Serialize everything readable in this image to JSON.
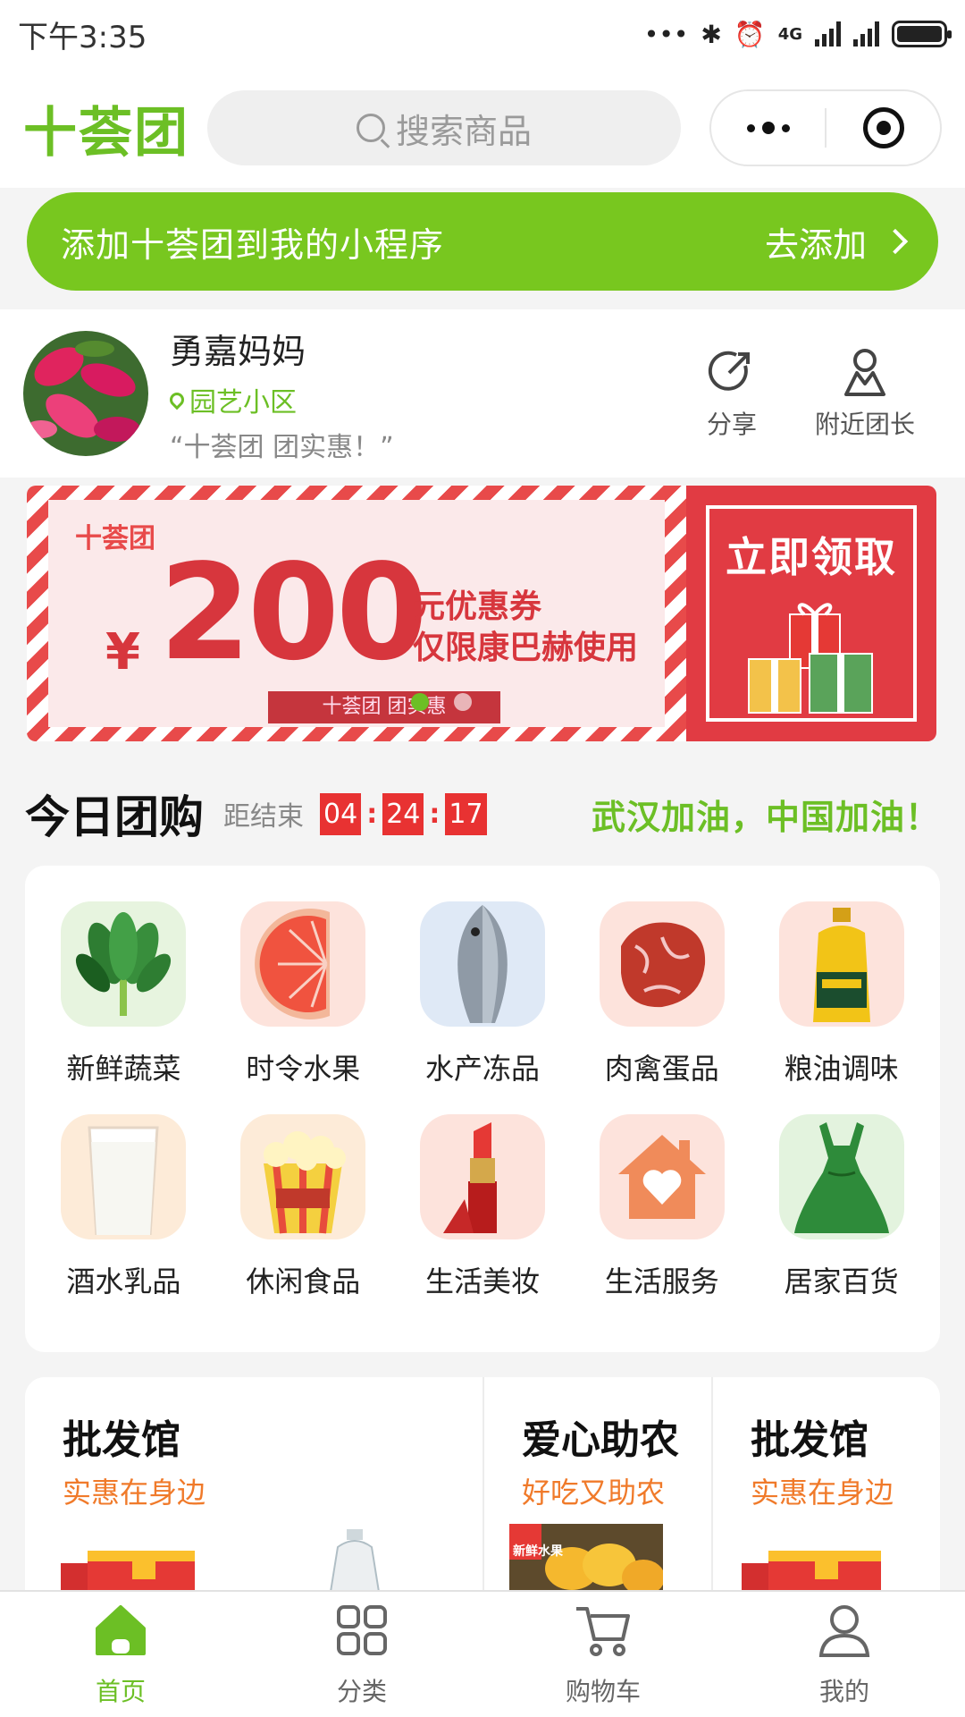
{
  "status_bar": {
    "time": "下午3:35",
    "network": "4G"
  },
  "header": {
    "logo": "十荟团",
    "search_placeholder": "搜索商品"
  },
  "add_banner": {
    "text": "添加十荟团到我的小程序",
    "action": "去添加"
  },
  "leader": {
    "name": "勇嘉妈妈",
    "location": "园艺小区",
    "quote": "“十荟团 团实惠！”",
    "share_label": "分享",
    "nearby_label": "附近团长"
  },
  "coupon": {
    "brand": "十荟团",
    "currency": "¥",
    "amount": "200",
    "unit": "元优惠券",
    "limit": "仅限康巴赫使用",
    "ribbon": "十荟团 团实惠",
    "cta": "立即领取",
    "slide_index": 1,
    "slide_count": 2
  },
  "today": {
    "title": "今日团购",
    "ends_label": "距结束",
    "countdown": [
      "04",
      "24",
      "17"
    ],
    "slogan": "武汉加油，中国加油！"
  },
  "categories": [
    {
      "label": "新鲜蔬菜",
      "icon": "vegetable-icon",
      "bg": "#e7f4df"
    },
    {
      "label": "时令水果",
      "icon": "grapefruit-icon",
      "bg": "#fde3dc"
    },
    {
      "label": "水产冻品",
      "icon": "fish-icon",
      "bg": "#dfe9f6"
    },
    {
      "label": "肉禽蛋品",
      "icon": "meat-icon",
      "bg": "#fde3dc"
    },
    {
      "label": "粮油调味",
      "icon": "oil-bottle-icon",
      "bg": "#fde3dc"
    },
    {
      "label": "酒水乳品",
      "icon": "milk-glass-icon",
      "bg": "#fdebd8"
    },
    {
      "label": "休闲食品",
      "icon": "popcorn-icon",
      "bg": "#fdebd8"
    },
    {
      "label": "生活美妆",
      "icon": "lipstick-icon",
      "bg": "#fde3dc"
    },
    {
      "label": "生活服务",
      "icon": "house-heart-icon",
      "bg": "#fde3dc"
    },
    {
      "label": "居家百货",
      "icon": "dress-icon",
      "bg": "#e3f3de"
    }
  ],
  "promos": [
    {
      "title": "批发馆",
      "subtitle": "实惠在身边"
    },
    {
      "title": "爱心助农",
      "subtitle": "好吃又助农",
      "badge": "新鲜水果"
    },
    {
      "title": "批发馆",
      "subtitle": "实惠在身边"
    }
  ],
  "tabbar": [
    {
      "label": "首页",
      "icon": "home-icon",
      "active": true
    },
    {
      "label": "分类",
      "icon": "grid-icon",
      "active": false
    },
    {
      "label": "购物车",
      "icon": "cart-icon",
      "active": false
    },
    {
      "label": "我的",
      "icon": "user-icon",
      "active": false
    }
  ],
  "colors": {
    "brand_green": "#6cbf25",
    "banner_green": "#78c71f",
    "countdown_red": "#e83232",
    "subtitle_orange": "#f07a2a"
  }
}
